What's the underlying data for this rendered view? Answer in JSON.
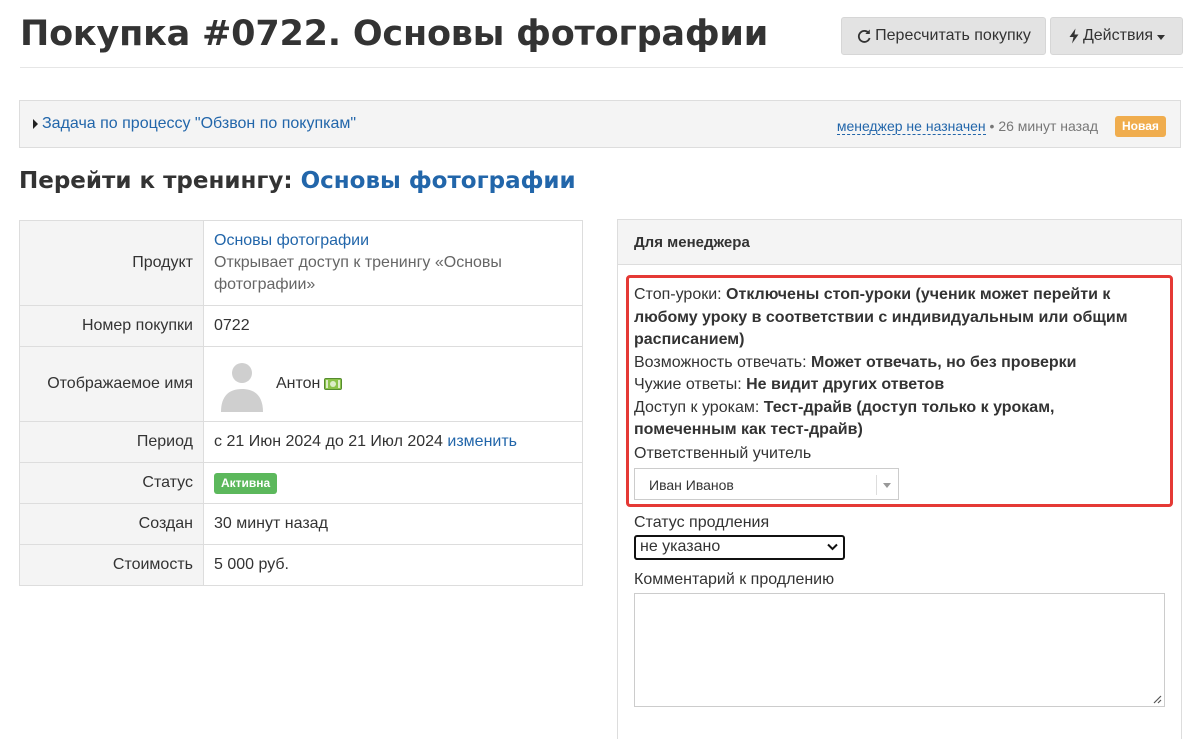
{
  "header": {
    "title": "Покупка #0722. Основы фотографии",
    "recalc_label": "Пересчитать покупку",
    "actions_label": "Действия"
  },
  "task": {
    "link": "Задача по процессу \"Обзвон по покупкам\"",
    "manager": "менеджер не назначен",
    "time": "• 26 минут назад",
    "badge": "Новая"
  },
  "training": {
    "prefix": "Перейти к тренингу: ",
    "link": "Основы фотографии"
  },
  "info": {
    "product_label": "Продукт",
    "product_link": "Основы фотографии",
    "product_desc": "Открывает доступ к тренингу «Основы фотографии»",
    "number_label": "Номер покупки",
    "number_value": "0722",
    "name_label": "Отображаемое имя",
    "name_value": "Антон",
    "period_label": "Период",
    "period_value": "с 21 Июн 2024 до 21 Июл 2024",
    "period_change": "изменить",
    "status_label": "Статус",
    "status_value": "Активна",
    "created_label": "Создан",
    "created_value": "30 минут назад",
    "cost_label": "Стоимость",
    "cost_value": "5 000 руб."
  },
  "manager_panel": {
    "heading": "Для менеджера",
    "stop_label": "Стоп-уроки: ",
    "stop_value": "Отключены стоп-уроки (ученик может перейти к любому уроку в соответствии с индивидуальным или общим расписанием)",
    "answer_label": "Возможность отвечать: ",
    "answer_value": "Может отвечать, но без проверки",
    "others_label": "Чужие ответы: ",
    "others_value": "Не видит других ответов",
    "access_label": "Доступ к урокам: ",
    "access_value": "Тест-драйв (доступ только к урокам, помеченным как тест-драйв)",
    "teacher_label": "Ответственный учитель",
    "teacher_value": "Иван Иванов",
    "extension_label": "Статус продления",
    "extension_value": "не указано",
    "comment_label": "Комментарий к продлению",
    "comment_value": ""
  },
  "colors": {
    "link": "#2266aa",
    "badge_new": "#f0ad4e",
    "badge_active": "#5cb85c",
    "highlight_border": "#e53935"
  }
}
